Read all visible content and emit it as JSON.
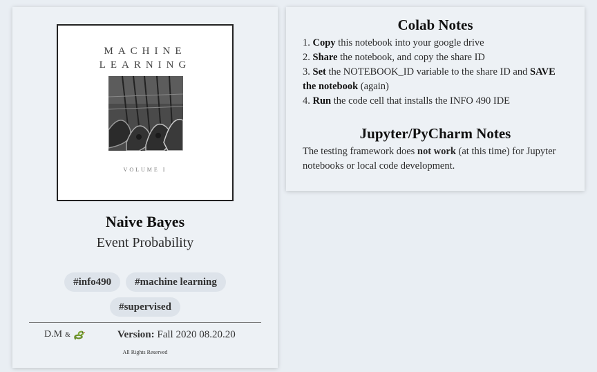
{
  "course_card": {
    "cover": {
      "title_line1": "MACHINE",
      "title_line2": "LEARNING",
      "volume": "VOLUME I"
    },
    "title": "Naive Bayes",
    "subtitle": "Event Probability",
    "tags": [
      "#info490",
      "#machine learning",
      "#supervised"
    ],
    "author": "D.M",
    "author_amp": "&",
    "author_icon": "snake-icon",
    "version_label": "Version:",
    "version_value": "Fall 2020 08.20.20",
    "rights": "All Rights Reserved"
  },
  "notes": {
    "colab_title": "Colab Notes",
    "colab_steps": [
      {
        "num": "1.",
        "bold": "Copy",
        "text": " this notebook into your google drive"
      },
      {
        "num": "2.",
        "bold": "Share",
        "text": " the notebook, and copy the share ID"
      },
      {
        "num": "3.",
        "bold": "Set",
        "text": " the NOTEBOOK_ID variable to the share ID and ",
        "bold2": "SAVE the notebook",
        "text2": " (again)"
      },
      {
        "num": "4.",
        "bold": "Run",
        "text": " the code cell that installs the INFO 490 IDE"
      }
    ],
    "jupyter_title": "Jupyter/PyCharm Notes",
    "jupyter_text_pre": "The testing framework does ",
    "jupyter_text_bold": "not work",
    "jupyter_text_post": " (at this time) for Jupyter notebooks or local code development."
  }
}
